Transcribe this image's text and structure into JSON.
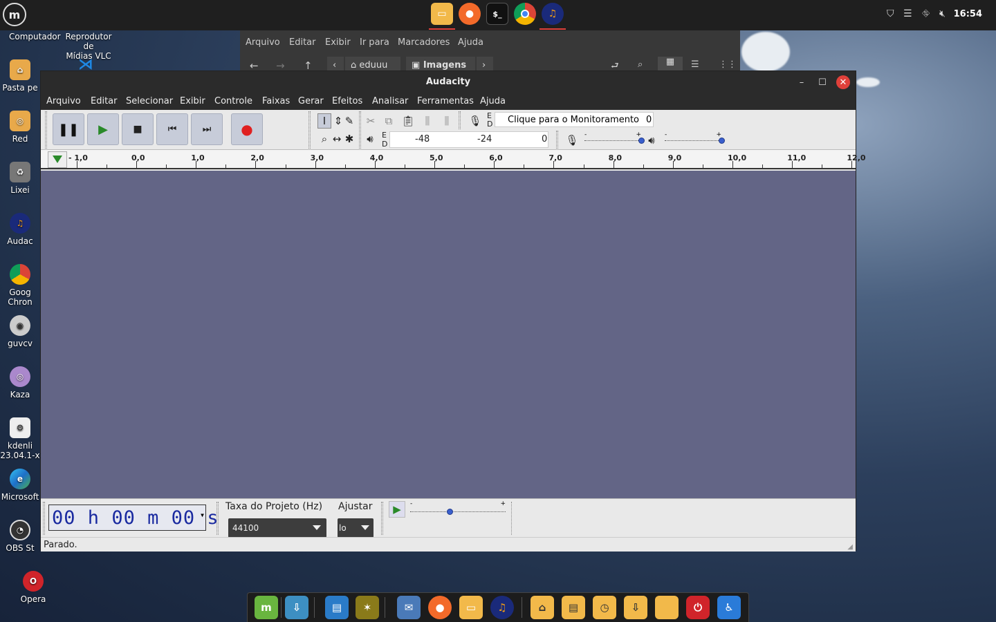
{
  "panel": {
    "clock": "16:54",
    "tray_icons": [
      "shield-icon",
      "notes-icon",
      "network-icon",
      "volume-muted-icon"
    ],
    "task_icons": [
      "folder-icon",
      "firefox-icon",
      "terminal-icon",
      "chrome-icon",
      "audacity-icon"
    ],
    "terminal_glyph": "$_"
  },
  "desktop": {
    "top_labels": [
      {
        "line1": "Computador",
        "line2": ""
      },
      {
        "line1": "Reprodutor de",
        "line2": "Mídias VLC"
      }
    ],
    "items": [
      {
        "label": "Pasta pe",
        "label2": "",
        "icon": "home-folder-icon",
        "color": "#e8a94a"
      },
      {
        "label": "Red",
        "label2": "",
        "icon": "network-folder-icon",
        "color": "#e8a94a"
      },
      {
        "label": "Lixei",
        "label2": "",
        "icon": "trash-icon",
        "color": "#888888"
      },
      {
        "label": "Audac",
        "label2": "",
        "icon": "audacity-icon",
        "color": "#1a2a7a"
      },
      {
        "label": "Goog",
        "label2": "Chron",
        "icon": "chrome-icon",
        "color": "#3a7bd5"
      },
      {
        "label": "guvcv",
        "label2": "",
        "icon": "webcam-icon",
        "color": "#cccccc"
      },
      {
        "label": "Kaza",
        "label2": "",
        "icon": "kazam-icon",
        "color": "#aa88cc"
      },
      {
        "label": "kdenli",
        "label2": "23.04.1-x",
        "icon": "kdenlive-icon",
        "color": "#eeeeee"
      },
      {
        "label": "Microsoft",
        "label2": "",
        "icon": "edge-icon",
        "color": "#1e88c8"
      },
      {
        "label": "OBS St",
        "label2": "",
        "icon": "obs-icon",
        "color": "#333333"
      },
      {
        "label": "Opera",
        "label2": "",
        "icon": "opera-icon",
        "color": "#d0242a"
      }
    ]
  },
  "file_manager": {
    "menu": [
      "Arquivo",
      "Editar",
      "Exibir",
      "Ir para",
      "Marcadores",
      "Ajuda"
    ],
    "path": [
      "eduuu",
      "Imagens"
    ]
  },
  "audacity": {
    "title": "Audacity",
    "menu": [
      "Arquivo",
      "Editar",
      "Selecionar",
      "Exibir",
      "Controle",
      "Faixas",
      "Gerar",
      "Efeitos",
      "Analisar",
      "Ferramentas",
      "Ajuda"
    ],
    "transport": [
      "pause",
      "play",
      "stop",
      "skip-start",
      "skip-end",
      "record"
    ],
    "monitor_text": "Clique para o Monitoramento",
    "monitor_value": "0",
    "meter_labels": {
      "record_e": "E",
      "record_d": "D",
      "play_e": "E",
      "play_d": "D"
    },
    "playback_scale": [
      "-48",
      "-24",
      "0"
    ],
    "recording_volume": 1.0,
    "playback_volume": 1.0,
    "ruler_labels": [
      "- 1,0",
      "0,0",
      "1,0",
      "2,0",
      "3,0",
      "4,0",
      "5,0",
      "6,0",
      "7,0",
      "8,0",
      "9,0",
      "10,0",
      "11,0",
      "12,0"
    ],
    "time_display": {
      "hh": "00",
      "h": "h",
      "mm": "00",
      "m": "m",
      "ss": "00",
      "s": "s"
    },
    "project_rate_label": "Taxa do Projeto (Hz)",
    "project_rate_value": "44100",
    "snap_label": "Ajustar",
    "snap_value": "lo",
    "play_speed": 0.4,
    "status": "Parado."
  },
  "dock": {
    "icons": [
      "mint-menu-icon",
      "update-manager-icon",
      "text-editor-icon",
      "image-viewer-icon",
      "mail-icon",
      "firefox-icon",
      "folder-icon",
      "audacity-icon",
      "home-folder-icon",
      "documents-folder-icon",
      "recent-folder-icon",
      "downloads-folder-icon",
      "folder-icon",
      "power-icon",
      "accessibility-icon"
    ]
  }
}
